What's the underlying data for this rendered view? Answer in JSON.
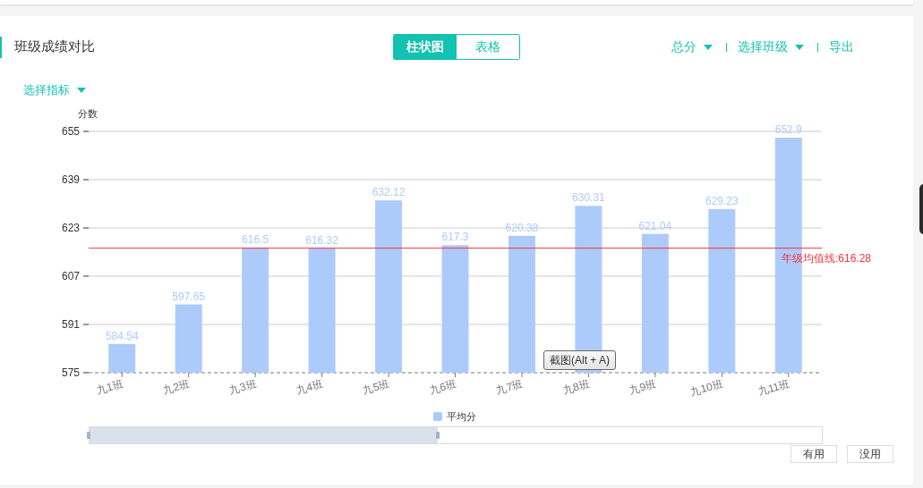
{
  "panel": {
    "title": "班级成绩对比",
    "view_tabs": [
      {
        "label": "柱状图",
        "selected": true
      },
      {
        "label": "表格",
        "selected": false
      }
    ],
    "actions": [
      {
        "kind": "dropdown",
        "label": "总分"
      },
      {
        "kind": "dropdown",
        "label": "选择班级"
      },
      {
        "kind": "link",
        "label": "导出"
      }
    ],
    "metric_dropdown": {
      "label": "选择指标"
    },
    "chart_data": {
      "type": "bar",
      "ylabel": "分数",
      "categories": [
        "九1班",
        "九2班",
        "九3班",
        "九4班",
        "九5班",
        "九6班",
        "九7班",
        "九8班",
        "九9班",
        "九10班",
        "九11班"
      ],
      "series": [
        {
          "name": "平均分",
          "color": "#adcbfa",
          "values": [
            584.54,
            597.65,
            616.5,
            616.32,
            632.12,
            617.3,
            620.38,
            630.31,
            621.04,
            629.23,
            652.9
          ]
        }
      ],
      "ylim": [
        575,
        655
      ],
      "yticks": [
        575,
        591,
        607,
        623,
        639,
        655
      ],
      "data_labels": true,
      "grid": true,
      "ref_lines": [
        {
          "axis": "y",
          "value": 616.28,
          "label": "年级均值线:616.28",
          "color": "#f0333a"
        }
      ]
    },
    "tooltip": "截图(Alt + A)",
    "zoom_slider": {
      "level": 0.476
    },
    "buttons": [
      "有用",
      "没用"
    ]
  }
}
